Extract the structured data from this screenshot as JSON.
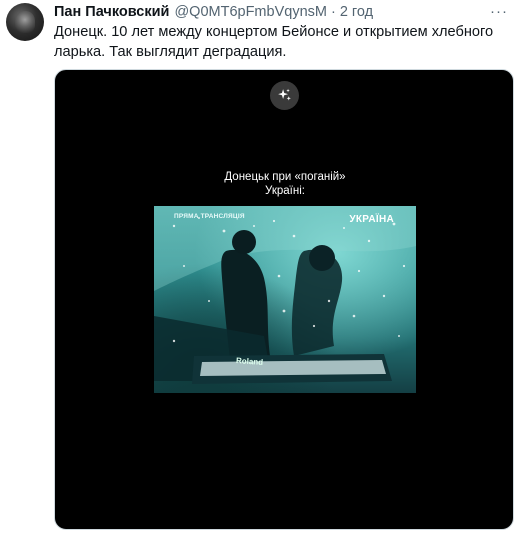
{
  "tweet": {
    "author": {
      "name": "Пан Пачковский",
      "handle": "@Q0MT6pFmbVqynsM",
      "separator": "·",
      "time": "2 год"
    },
    "more_label": "···",
    "text": "Донецк. 10 лет между концертом Бейонсе и открытием хлебного ларька. Так выглядит деградация.",
    "media": {
      "badge_icon": "sparkles-icon",
      "caption_line1": "Донецьк при «поганій»",
      "caption_line2": "Україні:",
      "video": {
        "live_label": "ПРЯМА ТРАНСЛЯЦІЯ",
        "channel_label": "УКРАЇНА",
        "brand_label": "Roland"
      }
    }
  },
  "colors": {
    "text_primary": "#0f1419",
    "text_secondary": "#536471",
    "media_background": "#000000",
    "video_tint": "#3aa3a2"
  }
}
